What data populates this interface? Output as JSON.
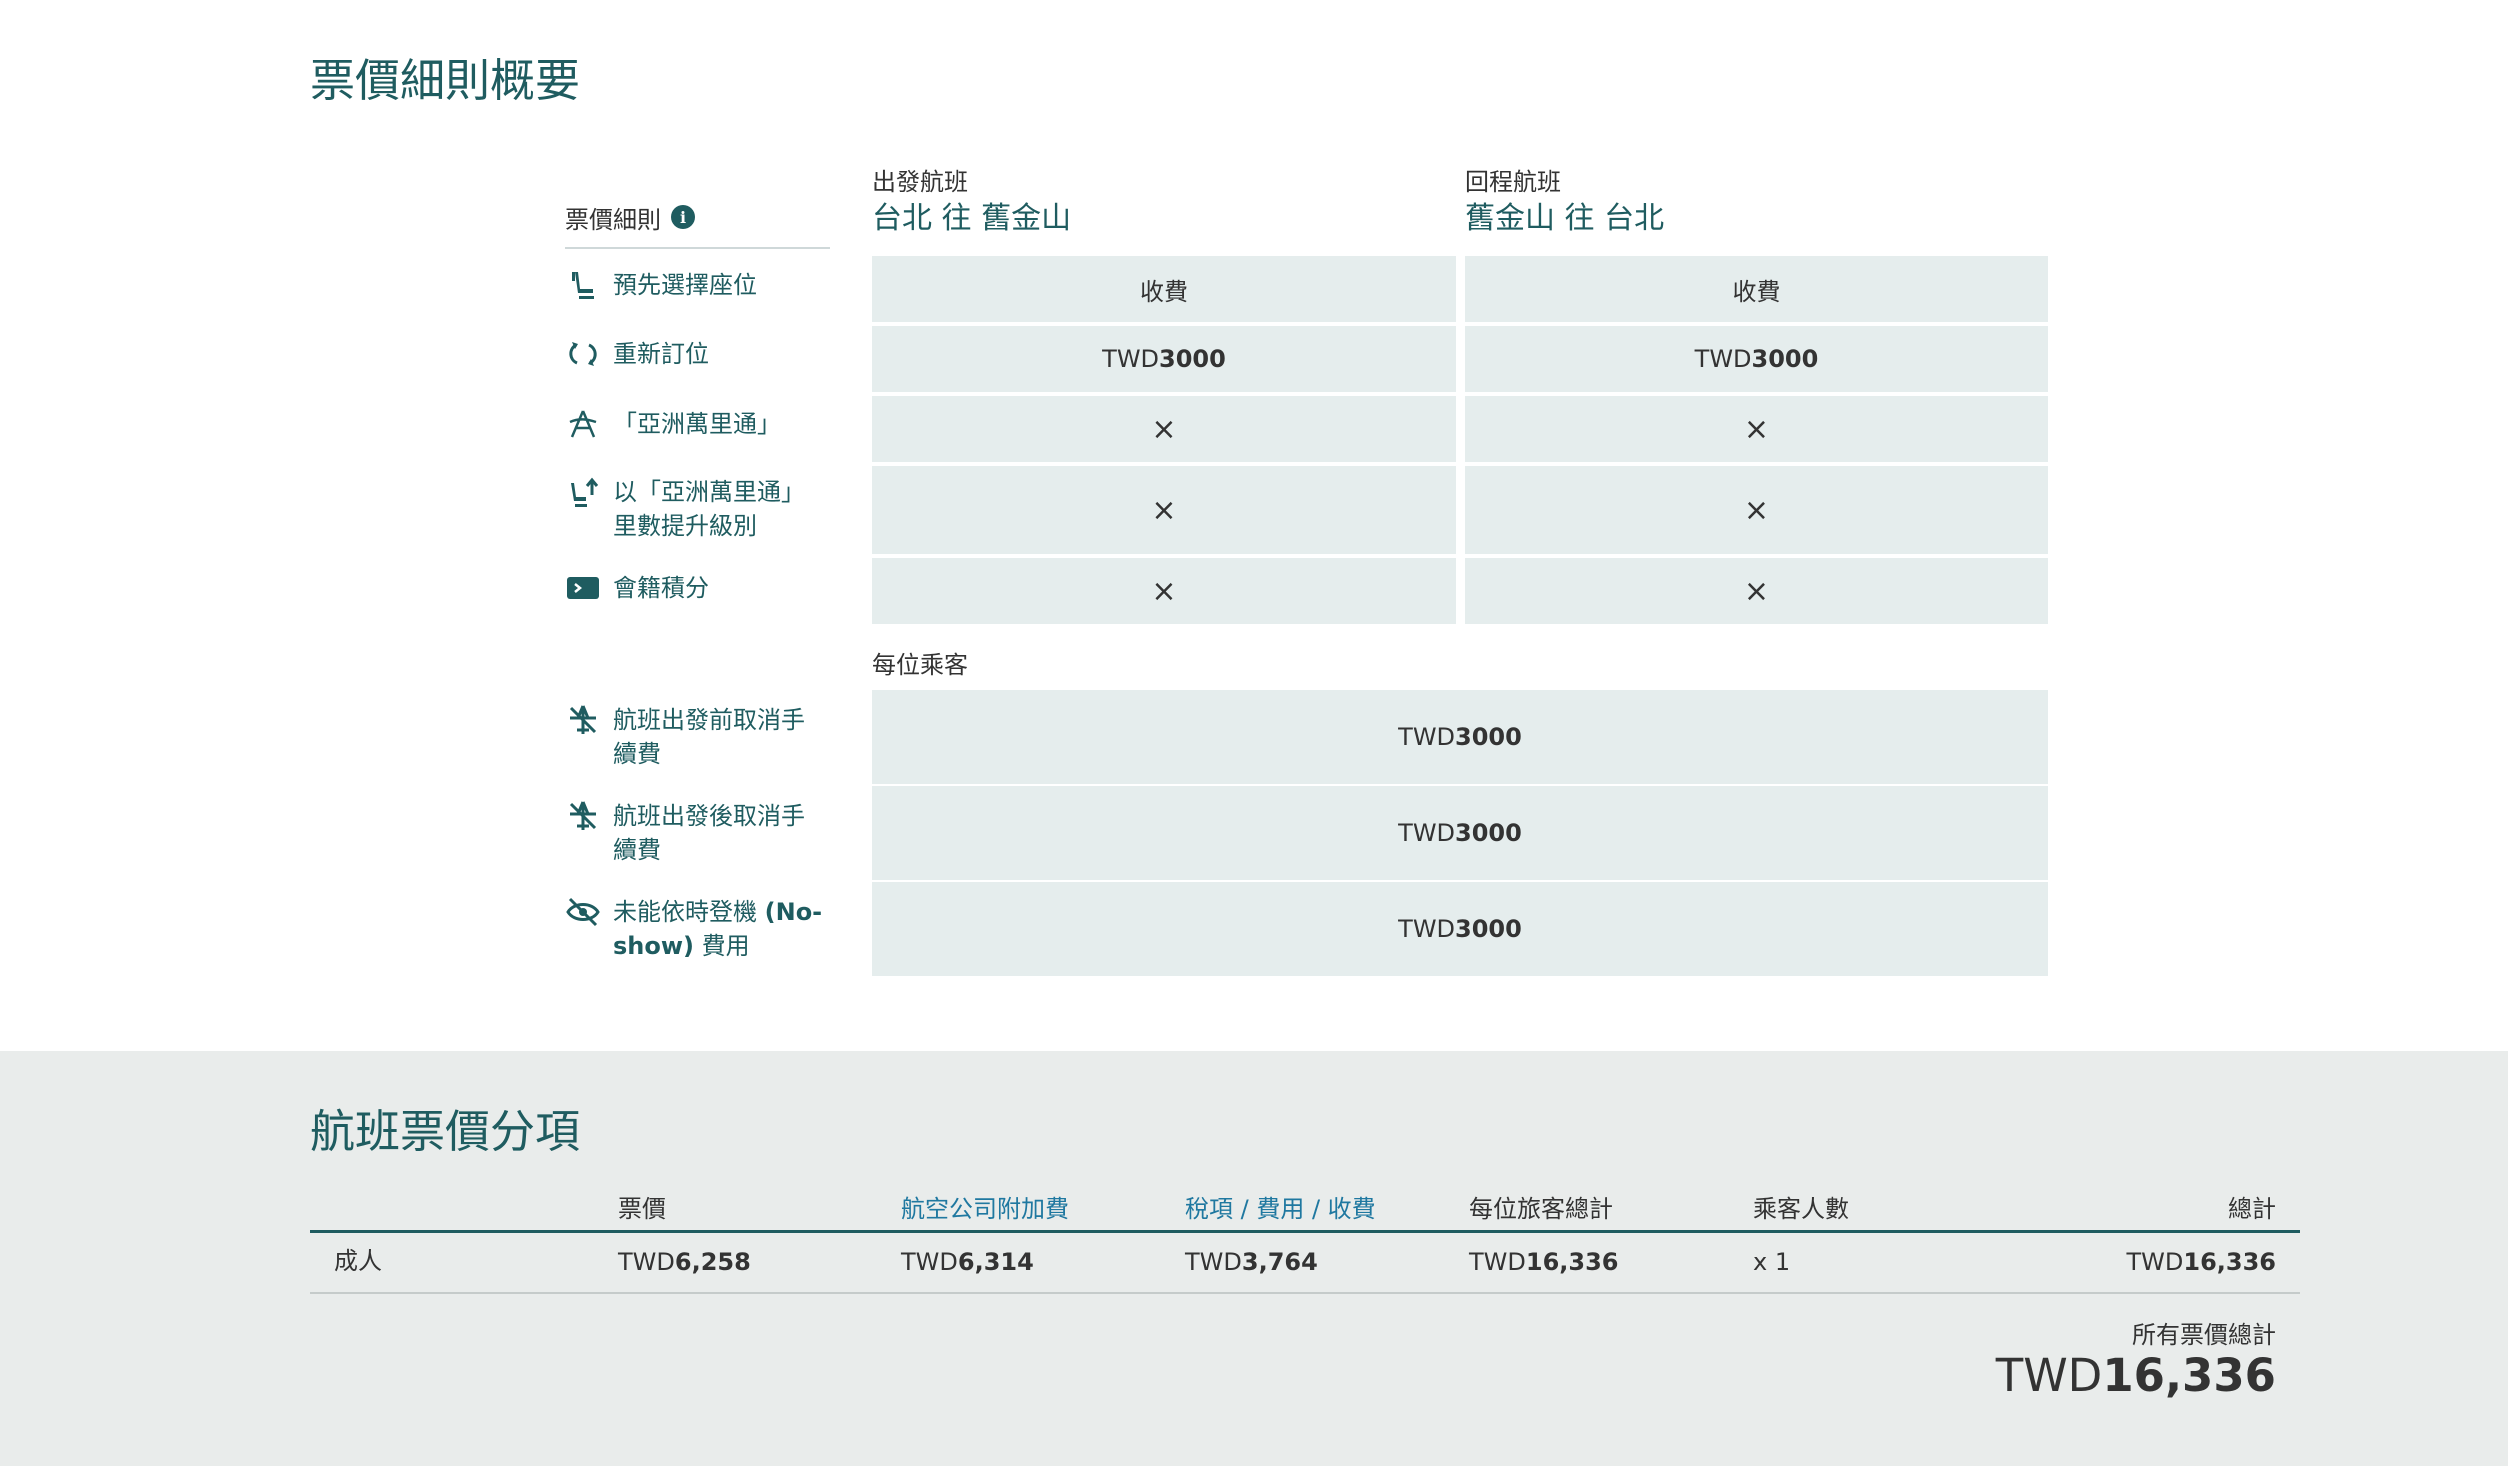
{
  "summary": {
    "title": "票價細則概要",
    "rules_header": "票價細則",
    "info_icon_text": "i",
    "rows": [
      {
        "label": "預先選擇座位",
        "icon": "seat-icon"
      },
      {
        "label": "重新訂位",
        "icon": "rebook-icon"
      },
      {
        "label": "「亞洲萬里通」",
        "icon": "asia-miles-icon"
      },
      {
        "label": "以「亞洲萬里通」里數提升級別",
        "icon": "upgrade-seat-icon"
      },
      {
        "label": "會籍積分",
        "icon": "status-points-icon"
      }
    ],
    "outbound": {
      "sub": "出發航班",
      "route": "台北 往 舊金山",
      "cells": [
        "收費",
        "TWD",
        "3000",
        "×",
        "×",
        "×"
      ]
    },
    "inbound": {
      "sub": "回程航班",
      "route": "舊金山 往 台北",
      "cells": [
        "收費",
        "TWD",
        "3000",
        "×",
        "×",
        "×"
      ]
    },
    "per_passenger_label": "每位乘客",
    "per_passenger_rows": [
      {
        "label": "航班出發前取消手續費",
        "icon": "cancel-before-icon",
        "currency": "TWD",
        "amount": "3000"
      },
      {
        "label": "航班出發後取消手續費",
        "icon": "cancel-after-icon",
        "currency": "TWD",
        "amount": "3000"
      },
      {
        "label_a": "未能依時登機 ",
        "label_b": "(No-show)",
        "label_c": " 費用",
        "icon": "no-show-icon",
        "currency": "TWD",
        "amount": "3000"
      }
    ]
  },
  "breakdown": {
    "title": "航班票價分項",
    "columns": {
      "fare": "票價",
      "surcharge": "航空公司附加費",
      "taxes": "稅項 / 費用 / 收費",
      "per_pax_total": "每位旅客總計",
      "pax_count": "乘客人數",
      "total": "總計"
    },
    "row": {
      "type": "成人",
      "fare_cur": "TWD",
      "fare_amt": "6,258",
      "surcharge_cur": "TWD",
      "surcharge_amt": "6,314",
      "taxes_cur": "TWD",
      "taxes_amt": "3,764",
      "per_pax_cur": "TWD",
      "per_pax_amt": "16,336",
      "pax_count": "x 1",
      "total_cur": "TWD",
      "total_amt": "16,336"
    },
    "grand_label": "所有票價總計",
    "grand_cur": "TWD",
    "grand_amt": "16,336"
  },
  "colors": {
    "brand_teal": "#1f5c60",
    "link_blue": "#1f78a0",
    "cell_bg": "#e5eded",
    "bottom_bg": "#e9eceb"
  }
}
